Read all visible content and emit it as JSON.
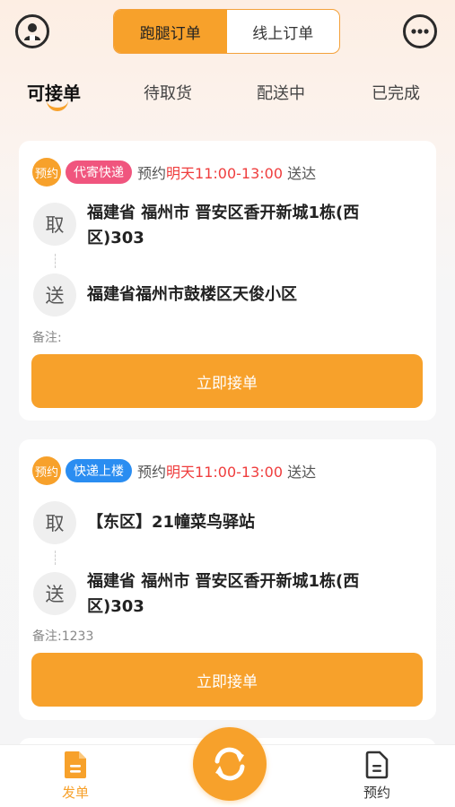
{
  "header": {
    "segments": [
      {
        "label": "跑腿订单",
        "active": true
      },
      {
        "label": "线上订单",
        "active": false
      }
    ],
    "left_icon": "user-avatar-icon",
    "right_icon": "chat-bubble-icon"
  },
  "tabs": [
    {
      "label": "可接单",
      "active": true
    },
    {
      "label": "待取货",
      "active": false
    },
    {
      "label": "配送中",
      "active": false
    },
    {
      "label": "已完成",
      "active": false
    }
  ],
  "orders": [
    {
      "badge": "预约",
      "tag": "代寄快递",
      "tag_color": "#f0557e",
      "appt_prefix": "预约",
      "appt_time": "明天11:00-13:00",
      "appt_suffix": "送达",
      "pickup_label": "取",
      "pickup_address": "福建省 福州市 晋安区香开新城1栋(西区)303",
      "deliver_label": "送",
      "deliver_address": "福建省福州市鼓楼区天俊小区",
      "remark": "备注:",
      "button": "立即接单"
    },
    {
      "badge": "预约",
      "tag": "快递上楼",
      "tag_color": "#2a8df1",
      "appt_prefix": "预约",
      "appt_time": "明天11:00-13:00",
      "appt_suffix": "送达",
      "pickup_label": "取",
      "pickup_address": "【东区】21幢菜鸟驿站",
      "deliver_label": "送",
      "deliver_address": "福建省 福州市 晋安区香开新城1栋(西区)303",
      "remark": "备注:1233",
      "button": "立即接单"
    }
  ],
  "bottom_nav": {
    "left": {
      "label": "发单",
      "icon": "dispatch-doc-icon",
      "active": true
    },
    "center": {
      "icon": "refresh-icon"
    },
    "right": {
      "label": "预约",
      "icon": "appointment-doc-icon",
      "active": false
    }
  },
  "colors": {
    "accent": "#f7a12b",
    "time_red": "#ef3d3d"
  }
}
